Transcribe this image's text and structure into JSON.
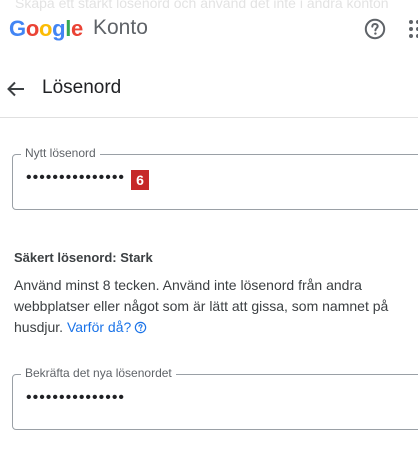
{
  "caption": "Skapa ett starkt lösenord och använd det inte i andra konton",
  "header": {
    "logo_text": "Google",
    "product_name": "Konto",
    "help_icon": "help-circle-icon",
    "apps_icon": "apps-grid-icon"
  },
  "subheader": {
    "back_icon": "arrow-back-icon",
    "title": "Lösenord"
  },
  "new_password": {
    "label": "Nytt lösenord",
    "value": "•••••••••••••••",
    "badge": "6"
  },
  "strength": {
    "title": "Säkert lösenord: Stark",
    "hint_line1": "Använd minst 8 tecken. Använd inte lösenord från andra",
    "hint_line2": "webbplatser eller något som är lätt att gissa, som namnet på",
    "hint_line3_prefix": "husdjur.",
    "link_label": "Varför då?"
  },
  "confirm_password": {
    "label": "Bekräfta det nya lösenordet",
    "value": "•••••••••••••••"
  },
  "colors": {
    "google_blue": "#4285f4",
    "google_red": "#ea4335",
    "google_yellow": "#fbbc05",
    "google_green": "#34a853",
    "link_blue": "#1a73e8",
    "badge_red": "#c62828"
  }
}
